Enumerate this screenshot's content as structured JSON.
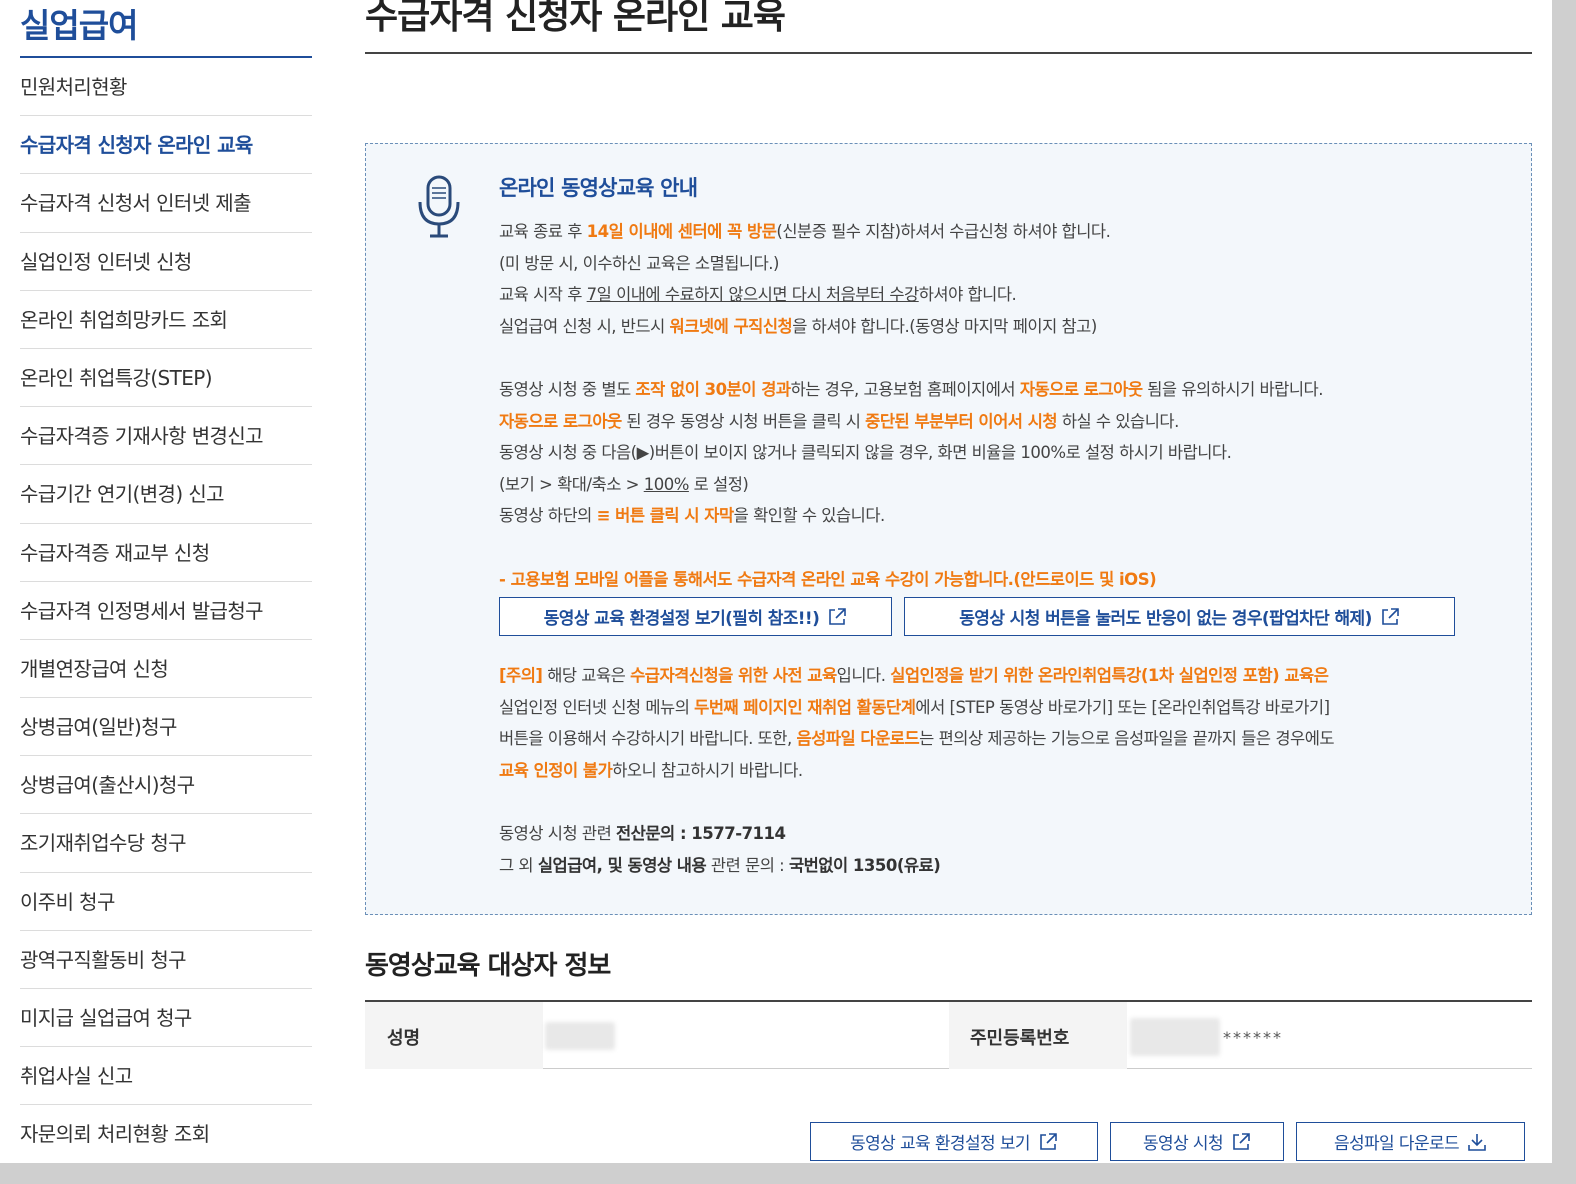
{
  "sidebar": {
    "title": "실업급여",
    "items": [
      {
        "label": "민원처리현황"
      },
      {
        "label": "수급자격 신청자 온라인 교육"
      },
      {
        "label": "수급자격 신청서 인터넷 제출"
      },
      {
        "label": "실업인정 인터넷 신청"
      },
      {
        "label": "온라인 취업희망카드 조회"
      },
      {
        "label": "온라인 취업특강(STEP)"
      },
      {
        "label": "수급자격증 기재사항 변경신고"
      },
      {
        "label": "수급기간 연기(변경) 신고"
      },
      {
        "label": "수급자격증 재교부 신청"
      },
      {
        "label": "수급자격 인정명세서 발급청구"
      },
      {
        "label": "개별연장급여 신청"
      },
      {
        "label": "상병급여(일반)청구"
      },
      {
        "label": "상병급여(출산시)청구"
      },
      {
        "label": "조기재취업수당 청구"
      },
      {
        "label": "이주비 청구"
      },
      {
        "label": "광역구직활동비 청구"
      },
      {
        "label": "미지급 실업급여 청구"
      },
      {
        "label": "취업사실 신고"
      },
      {
        "label": "자문의뢰 처리현황 조회"
      }
    ]
  },
  "main": {
    "title": "수급자격 신청자 온라인 교육",
    "info": {
      "heading": "온라인 동영상교육 안내",
      "l1a": "교육 종료 후 ",
      "l1b": "14일 이내에 센터에 꼭 방문",
      "l1c": "(신분증 필수 지참)하셔서 수급신청 하셔야 합니다.",
      "l2": "(미 방문 시, 이수하신 교육은 소멸됩니다.)",
      "l3a": "교육 시작 후 ",
      "l3b": "7일 이내에 수료하지 않으시면 다시 처음부터 수강",
      "l3c": "하셔야 합니다.",
      "l4a": "실업급여 신청 시, 반드시 ",
      "l4b": "워크넷에 구직신청",
      "l4c": "을 하셔야 합니다.(동영상 마지막 페이지 참고)",
      "l5a": "동영상 시청 중 별도 ",
      "l5b": "조작 없이 30분이 경과",
      "l5c": "하는 경우, 고용보험 홈페이지에서 ",
      "l5d": "자동으로 로그아웃",
      "l5e": " 됨을 유의하시기 바랍니다.",
      "l6a": "자동으로 로그아웃",
      "l6b": " 된 경우 동영상 시청 버튼을 클릭 시 ",
      "l6c": "중단된 부분부터 이어서 시청",
      "l6d": " 하실 수 있습니다.",
      "l7": "동영상 시청 중 다음(▶)버튼이 보이지 않거나 클릭되지 않을 경우, 화면 비율을 100%로 설정 하시기 바랍니다.",
      "l8a": "(보기 > 확대/축소 > ",
      "l8b": "100%",
      "l8c": " 로 설정)",
      "l9a": "동영상 하단의 ",
      "l9b": "≡ 버튼 클릭 시 자막",
      "l9c": "을 확인할 수 있습니다.",
      "mobile_note": "- 고용보험 모바일 어플을 통해서도 수급자격 온라인 교육 수강이 가능합니다.(안드로이드 및 iOS)",
      "btn_env": "동영상 교육 환경설정 보기(필히 참조!!)",
      "btn_popup": "동영상 시청 버튼을 눌러도 반응이 없는 경우(팝업차단 해제)",
      "c1a": "[주의]",
      "c1b": " 해당 교육은 ",
      "c1c": "수급자격신청을 위한 사전 교육",
      "c1d": "입니다. ",
      "c1e": "실업인정을 받기 위한 온라인취업특강(1차 실업인정 포함) 교육은",
      "c2a": "실업인정 인터넷 신청 메뉴의 ",
      "c2b": "두번째 페이지인 재취업 활동단계",
      "c2c": "에서 [STEP 동영상 바로가기] 또는 [온라인취업특강 바로가기]",
      "c3a": "버튼을 이용해서 수강하시기 바랍니다. 또한, ",
      "c3b": "음성파일 다운로드",
      "c3c": "는 편의상 제공하는 기능으로 음성파일을 끝까지 들은 경우에도",
      "c4a": "교육 인정이 불가",
      "c4b": "하오니 참고하시기 바랍니다.",
      "q1a": "동영상 시청 관련 ",
      "q1b": "전산문의 : 1577-7114",
      "q2a": "그 외 ",
      "q2b": "실업급여, 및 동영상 내용",
      "q2c": " 관련 문의 : ",
      "q2d": "국번없이 1350(유료)"
    },
    "subject": {
      "title": "동영상교육 대상자 정보",
      "name_label": "성명",
      "rrn_label": "주민등록번호",
      "rrn_masked": "******"
    },
    "buttons": {
      "env": "동영상 교육 환경설정 보기",
      "watch": "동영상 시청",
      "download": "음성파일 다운로드"
    }
  },
  "colors": {
    "primary": "#1f4e9a",
    "highlight": "#f07a12",
    "box_bg": "#f3f7fb"
  }
}
